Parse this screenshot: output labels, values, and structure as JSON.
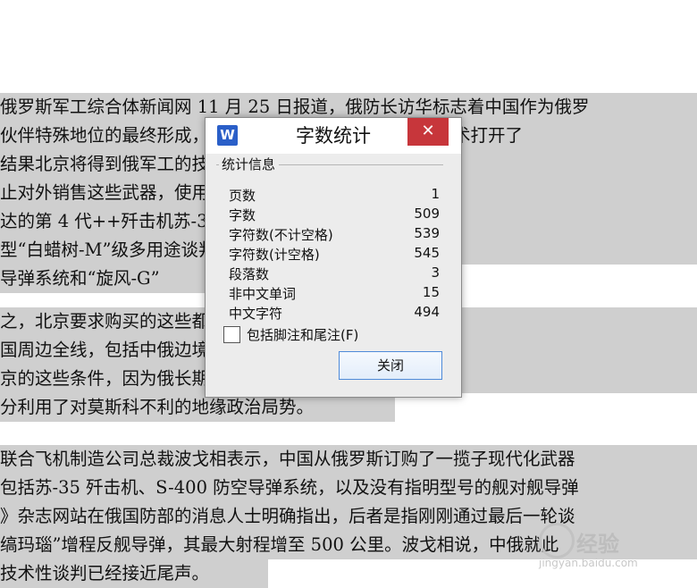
{
  "document": {
    "lines": [
      "俄罗斯军工综合体新闻网 11 月 25 日报道，俄防长访华标志着中国作为俄罗",
      "伙伴特殊地位的最终形成，中国将获得更重要的头等军事技术打开了",
      "结果北京将得到俄军工的技术研究和进一步的仿制。而出口",
      "止对外销售这些武器，使用 117S 发动机和 “雪",
      "达的第 4 代++歼击机苏-35。携带 P-800 战略巡航导弹",
      " 型“白蜡树-M”级多用途谈判 “伊斯坎德尔-M”战",
      "导弹系统和“旋风-G”",
      "",
      "之，北京要求购买的这些都是前景产品，能够实质性地",
      "国周边全线，包括中俄边境。专家认为，克里姆林宫将被迫",
      "京的这些条件，因为俄长期经济依赖。实质上，东方",
      "分利用了对莫斯科不利的地缘政治局势。",
      "",
      "联合飞机制造公司总裁波戈相表示，中国从俄罗斯订购了一揽子现代化武器",
      "包括苏-35 歼击机、S-400 防空导弹系统，以及没有指明型号的舰对舰导弹",
      "》杂志网站在俄国防部的消息人士明确指出，后者是指刚刚通过最后一轮谈",
      "缟玛瑙”增程反舰导弹，其最大射程增至 500 公里。波戈相说，中俄就此",
      "技术性谈判已经接近尾声。"
    ]
  },
  "dialog": {
    "title": "字数统计",
    "app_icon": "W",
    "close_glyph": "✕",
    "group_title": "统计信息",
    "stats": [
      {
        "label": "页数",
        "value": "1"
      },
      {
        "label": "字数",
        "value": "509"
      },
      {
        "label": "字符数(不计空格)",
        "value": "539"
      },
      {
        "label": "字符数(计空格)",
        "value": "545"
      },
      {
        "label": "段落数",
        "value": "3"
      },
      {
        "label": "非中文单词",
        "value": "15"
      },
      {
        "label": "中文字符",
        "value": "494"
      }
    ],
    "include_footnotes_label": "包括脚注和尾注(F)",
    "include_footnotes_checked": false,
    "close_button": "关闭"
  },
  "watermark": {
    "text": "经验",
    "url": "jingyan.baidu.com"
  },
  "colors": {
    "selection": "#cfcfcf",
    "close_red": "#c7363b",
    "button_border": "#4f8bd9",
    "app_icon_blue": "#2a5fc8"
  }
}
